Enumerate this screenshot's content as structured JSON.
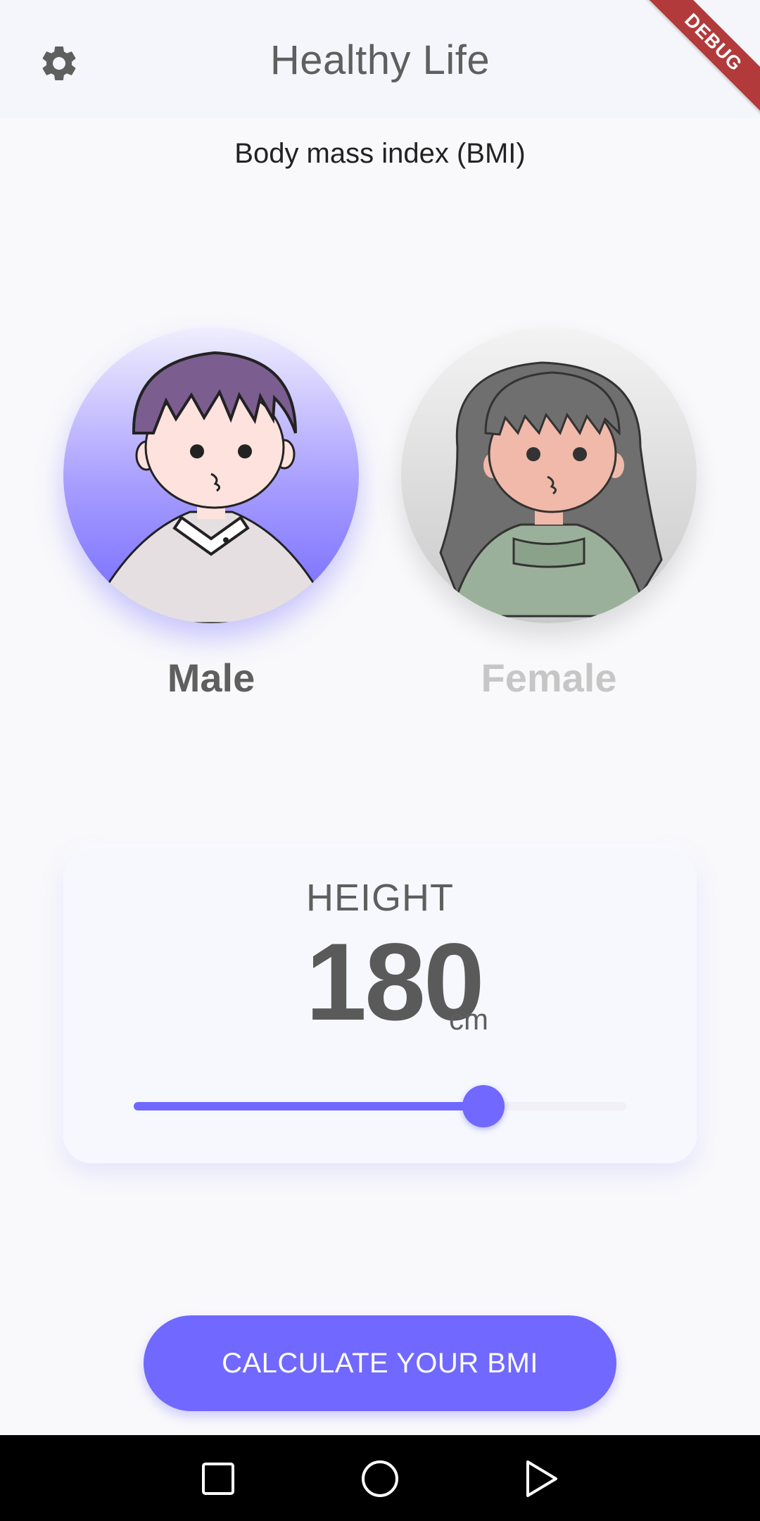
{
  "app_bar": {
    "title": "Healthy Life",
    "settings_icon": "gear-icon",
    "debug_banner": "DEBUG"
  },
  "subtitle": "Body mass index (BMI)",
  "gender": {
    "selected": "male",
    "options": [
      {
        "id": "male",
        "label": "Male",
        "icon": "male-avatar"
      },
      {
        "id": "female",
        "label": "Female",
        "icon": "female-avatar"
      }
    ]
  },
  "height": {
    "label": "HEIGHT",
    "value": "180",
    "unit": "cm",
    "slider_fraction": 0.71
  },
  "cta": {
    "label": "CALCULATE YOUR BMI"
  },
  "colors": {
    "accent": "#7068ff",
    "text_primary": "#5f5f5f",
    "text_disabled": "#c6c6c6",
    "debug": "#b23a3a"
  },
  "nav": {
    "recent_icon": "square-icon",
    "home_icon": "circle-icon",
    "back_icon": "triangle-icon"
  }
}
